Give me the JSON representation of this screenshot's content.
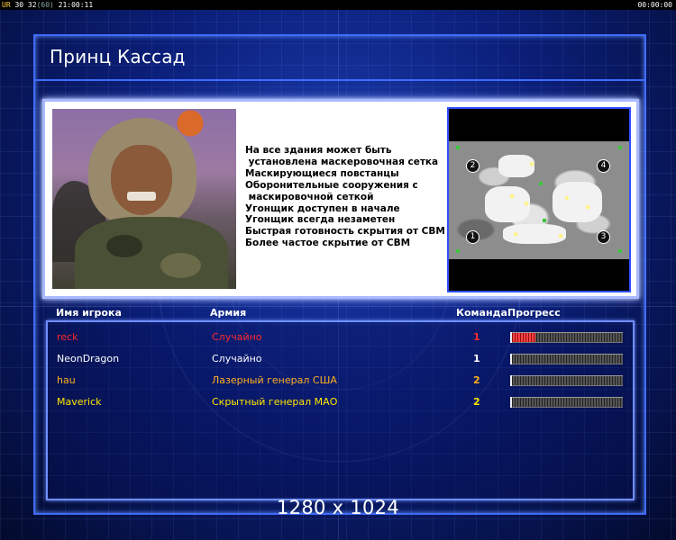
{
  "status_bar": {
    "left_prefix": "UR",
    "left_values": "30 32",
    "left_dim": "(60)",
    "left_time": "21:00:11",
    "right_time": "00:00:00"
  },
  "title": "Принц Кассад",
  "general": {
    "description": [
      "На все здания может быть",
      " установлена маскеровочная сетка",
      "Маскирующиеся повстанцы",
      "Оборонительные сооружения с",
      " маскировочной сеткой",
      "Угонщик доступен в начале",
      "Угонщик всегда незаметен",
      "Быстрая готовность скрытия от СВМ",
      "Более частое скрытие от СВМ"
    ]
  },
  "minimap": {
    "positions": [
      "1",
      "2",
      "3",
      "4"
    ]
  },
  "table": {
    "headers": {
      "name": "Имя игрока",
      "army": "Армия",
      "team": "Команда",
      "progress": "Прогресс"
    },
    "rows": [
      {
        "name": "reck",
        "army": "Случайно",
        "team": "1",
        "progress": 0.22,
        "name_color": "#ff2a2a",
        "army_color": "#ff2a2a",
        "team_color": "#ff2a2a"
      },
      {
        "name": "NeonDragon",
        "army": "Случайно",
        "team": "1",
        "progress": 0.0,
        "name_color": "#ffffff",
        "army_color": "#ffffff",
        "team_color": "#ffffff"
      },
      {
        "name": "hau",
        "army": "Лазерный генерал США",
        "team": "2",
        "progress": 0.0,
        "name_color": "#ffb020",
        "army_color": "#ffb020",
        "team_color": "#ffb020"
      },
      {
        "name": "Maverick",
        "army": "Скрытный генерал МАО",
        "team": "2",
        "progress": 0.0,
        "name_color": "#ffe600",
        "army_color": "#ffe600",
        "team_color": "#ffe600"
      }
    ]
  },
  "resolution_label": "1280 x 1024",
  "colors": {
    "accent": "#3f6cff",
    "background": "#0b1f7a"
  }
}
